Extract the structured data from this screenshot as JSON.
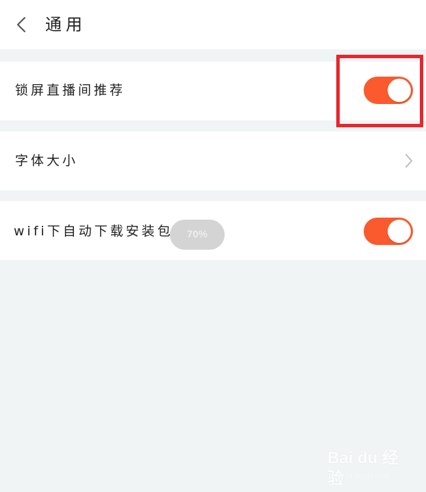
{
  "header": {
    "title": "通用"
  },
  "settings": {
    "lockscreen_live": {
      "label": "锁屏直播间推荐",
      "enabled": true
    },
    "font_size": {
      "label": "字体大小"
    },
    "wifi_autodownload": {
      "label": "wifi下自动下载安装包",
      "enabled": true,
      "overlay_badge": "70%"
    }
  },
  "icons": {
    "back": "chevron-left-icon",
    "font_size_chevron": "chevron-right-icon"
  },
  "colors": {
    "toggle_on": "#fa5a2d",
    "highlight": "#e8262c",
    "page_bg": "#f0f4f5"
  },
  "watermark": {
    "brand": "Bai du 经验",
    "url": "jingyan.baidu.com"
  }
}
